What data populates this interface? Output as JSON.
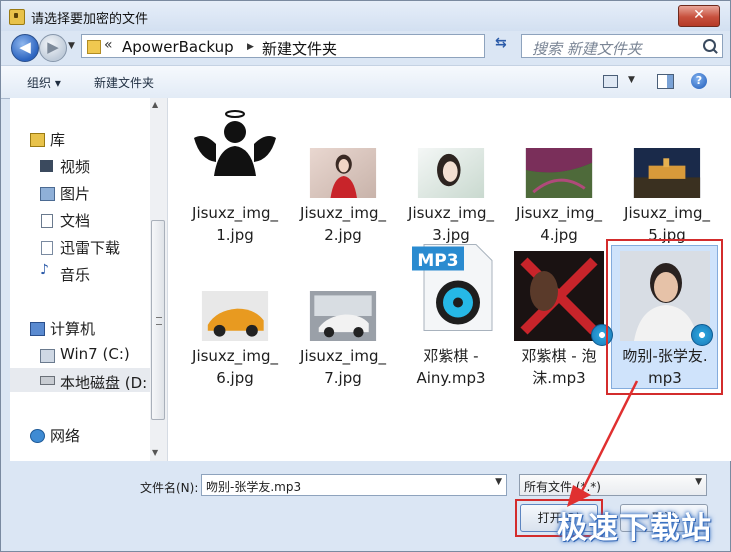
{
  "window": {
    "title": "请选择要加密的文件",
    "close": "✕"
  },
  "nav": {
    "back": "◀",
    "forward": "▶",
    "breadcrumb_prefix": "«",
    "breadcrumb": [
      "ApowerBackup",
      "新建文件夹"
    ],
    "search_placeholder": "搜索 新建文件夹"
  },
  "toolbar": {
    "organize": "组织 ▾",
    "new_folder": "新建文件夹"
  },
  "sidebar": {
    "library": "库",
    "items": [
      "视频",
      "图片",
      "文档",
      "迅雷下载",
      "音乐"
    ],
    "computer": "计算机",
    "drives": [
      "Win7 (C:)",
      "本地磁盘 (D:"
    ],
    "network": "网络"
  },
  "files": [
    {
      "name": "Jisuxz_img_1.jpg",
      "line1": "Jisuxz_img_",
      "line2": "1.jpg",
      "kind": "angel-icon"
    },
    {
      "name": "Jisuxz_img_2.jpg",
      "line1": "Jisuxz_img_",
      "line2": "2.jpg",
      "kind": "photo"
    },
    {
      "name": "Jisuxz_img_3.jpg",
      "line1": "Jisuxz_img_",
      "line2": "3.jpg",
      "kind": "photo"
    },
    {
      "name": "Jisuxz_img_4.jpg",
      "line1": "Jisuxz_img_",
      "line2": "4.jpg",
      "kind": "photo"
    },
    {
      "name": "Jisuxz_img_5.jpg",
      "line1": "Jisuxz_img_",
      "line2": "5.jpg",
      "kind": "photo"
    },
    {
      "name": "Jisuxz_img_6.jpg",
      "line1": "Jisuxz_img_",
      "line2": "6.jpg",
      "kind": "photo"
    },
    {
      "name": "Jisuxz_img_7.jpg",
      "line1": "Jisuxz_img_",
      "line2": "7.jpg",
      "kind": "photo"
    },
    {
      "name": "邓紫棋 - Ainy.mp3",
      "line1": "邓紫棋 -",
      "line2": "Ainy.mp3",
      "kind": "mp3-icon",
      "badge": "MP3"
    },
    {
      "name": "邓紫棋 - 泡沫.mp3",
      "line1": "邓紫棋 - 泡",
      "line2": "沫.mp3",
      "kind": "album"
    },
    {
      "name": "吻别-张学友.mp3",
      "line1": "吻别-张学友.",
      "line2": "mp3",
      "kind": "album",
      "selected": true
    }
  ],
  "footer": {
    "filename_label": "文件名(N):",
    "filename_value": "吻别-张学友.mp3",
    "filter_value": "所有文件 (*.*)",
    "open": "打开(O)",
    "cancel": "取消"
  },
  "watermark": "极速下载站",
  "colors": {
    "accent": "#3b73c4",
    "highlight": "#d32c2c",
    "selection": "#cfe3fb"
  }
}
